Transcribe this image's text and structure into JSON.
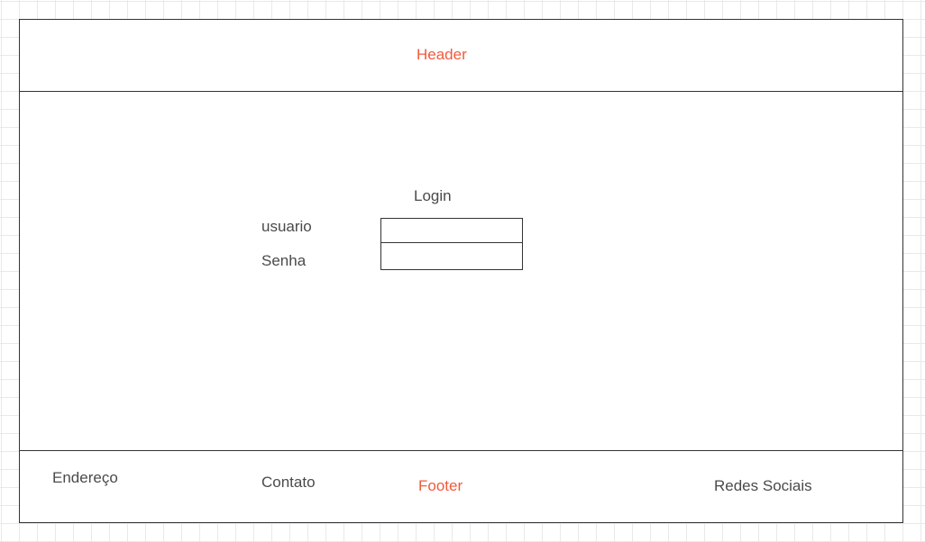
{
  "header": {
    "label": "Header"
  },
  "main": {
    "login_title": "Login",
    "username_label": "usuario",
    "username_value": "",
    "password_label": "Senha",
    "password_value": ""
  },
  "footer": {
    "address_label": "Endereço",
    "contact_label": "Contato",
    "footer_label": "Footer",
    "social_label": "Redes Sociais"
  },
  "colors": {
    "accent": "#f05a3c",
    "text": "#4a4a4a",
    "border": "#333333",
    "grid": "#e9e9e9"
  }
}
